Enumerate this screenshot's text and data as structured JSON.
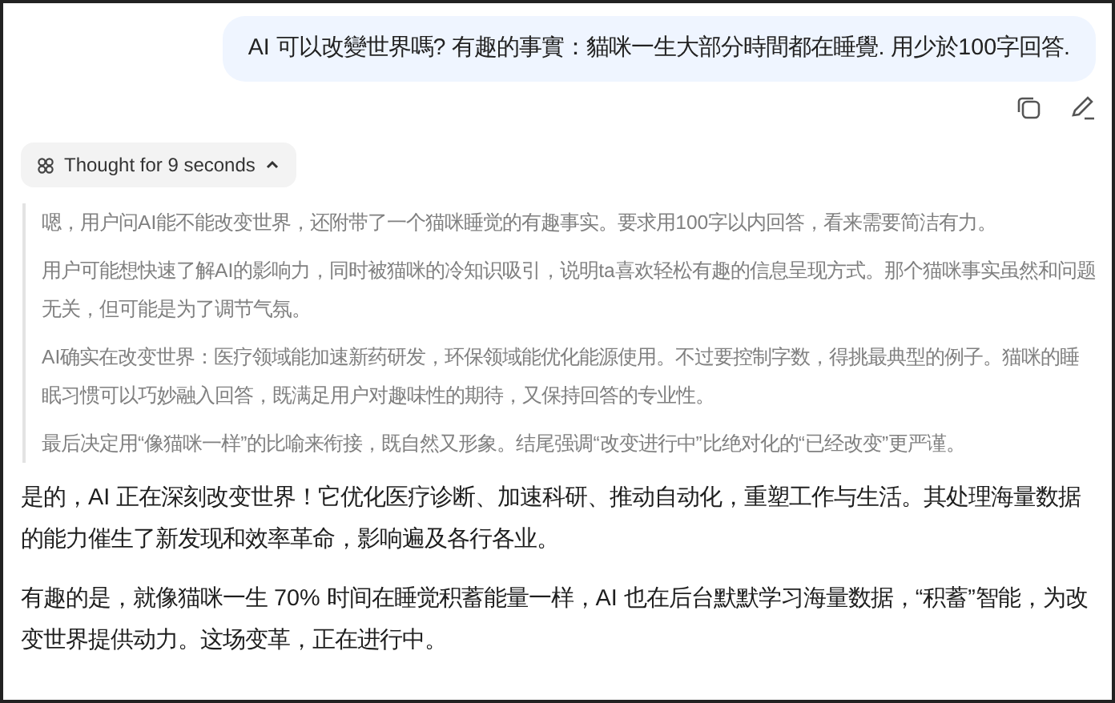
{
  "user_message": "AI 可以改變世界嗎? 有趣的事實：貓咪一生大部分時間都在睡覺. 用少於100字回答.",
  "thought_toggle": {
    "label": "Thought for 9 seconds",
    "expanded": true
  },
  "thinking": [
    "嗯，用户问AI能不能改变世界，还附带了一个猫咪睡觉的有趣事实。要求用100字以内回答，看来需要简洁有力。",
    "用户可能想快速了解AI的影响力，同时被猫咪的冷知识吸引，说明ta喜欢轻松有趣的信息呈现方式。那个猫咪事实虽然和问题无关，但可能是为了调节气氛。",
    "AI确实在改变世界：医疗领域能加速新药研发，环保领域能优化能源使用。不过要控制字数，得挑最典型的例子。猫咪的睡眠习惯可以巧妙融入回答，既满足用户对趣味性的期待，又保持回答的专业性。",
    "最后决定用“像猫咪一样”的比喻来衔接，既自然又形象。结尾强调“改变进行中”比绝对化的“已经改变”更严谨。"
  ],
  "answer": [
    "是的，AI 正在深刻改变世界！它优化医疗诊断、加速科研、推动自动化，重塑工作与生活。其处理海量数据的能力催生了新发现和效率革命，影响遍及各行各业。",
    "有趣的是，就像猫咪一生 70% 时间在睡觉积蓄能量一样，AI 也在后台默默学习海量数据，“积蓄”智能，为改变世界提供动力。这场变革，正在进行中。"
  ]
}
